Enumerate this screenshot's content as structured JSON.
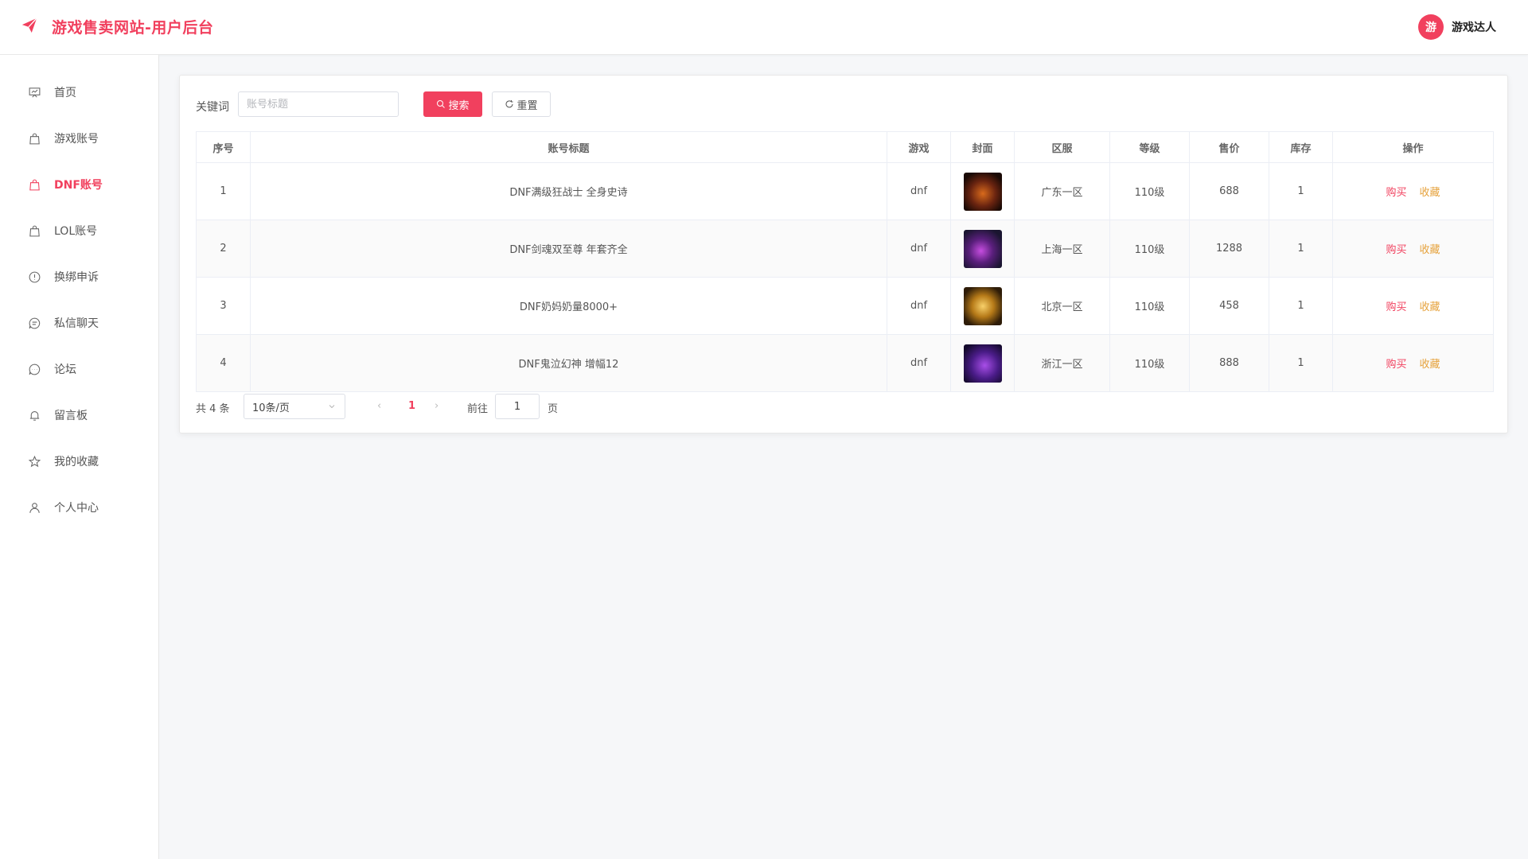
{
  "header": {
    "title": "游戏售卖网站-用户后台",
    "avatar_text": "游",
    "username": "游戏达人",
    "brand_color": "#f1405e"
  },
  "sidebar": {
    "items": [
      {
        "label": "首页",
        "icon": "presentation-icon"
      },
      {
        "label": "游戏账号",
        "icon": "shopping-bag-icon"
      },
      {
        "label": "DNF账号",
        "icon": "shopping-bag-icon",
        "active": true
      },
      {
        "label": "LOL账号",
        "icon": "shopping-bag-icon"
      },
      {
        "label": "换绑申诉",
        "icon": "warning-circle-icon"
      },
      {
        "label": "私信聊天",
        "icon": "chat-lines-icon"
      },
      {
        "label": "论坛",
        "icon": "chat-dots-icon"
      },
      {
        "label": "留言板",
        "icon": "bell-icon"
      },
      {
        "label": "我的收藏",
        "icon": "star-icon"
      },
      {
        "label": "个人中心",
        "icon": "user-icon"
      }
    ]
  },
  "search": {
    "label": "关键词",
    "placeholder": "账号标题",
    "value": "",
    "search_label": "搜索",
    "reset_label": "重置"
  },
  "table": {
    "headers": [
      "序号",
      "账号标题",
      "游戏",
      "封面",
      "区服",
      "等级",
      "售价",
      "库存",
      "操作"
    ],
    "rows": [
      {
        "index": "1",
        "title": "DNF满级狂战士 全身史诗",
        "game": "dnf",
        "server": "广东一区",
        "level": "110级",
        "price": "688",
        "stock": "1"
      },
      {
        "index": "2",
        "title": "DNF剑魂双至尊 年套齐全",
        "game": "dnf",
        "server": "上海一区",
        "level": "110级",
        "price": "1288",
        "stock": "1"
      },
      {
        "index": "3",
        "title": "DNF奶妈奶量8000+",
        "game": "dnf",
        "server": "北京一区",
        "level": "110级",
        "price": "458",
        "stock": "1"
      },
      {
        "index": "4",
        "title": "DNF鬼泣幻神 增幅12",
        "game": "dnf",
        "server": "浙江一区",
        "level": "110级",
        "price": "888",
        "stock": "1"
      }
    ],
    "buy_label": "购买",
    "fav_label": "收藏"
  },
  "pagination": {
    "total": "共 4 条",
    "page_size": "10条/页",
    "current_page": "1",
    "goto_label": "前往",
    "goto_value": "1",
    "page_suffix": "页"
  }
}
